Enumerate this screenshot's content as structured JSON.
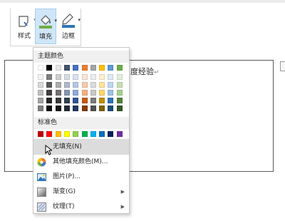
{
  "ribbon": {
    "style_label": "样式",
    "fill_label": "填充",
    "border_label": "边框"
  },
  "document": {
    "text": "度经验",
    "paragraph_mark": "↵"
  },
  "dropdown": {
    "theme_colors_title": "主题颜色",
    "standard_colors_title": "标准色",
    "theme_top_row": [
      "#ffffff",
      "#000000",
      "#e7e6e6",
      "#44546a",
      "#4472c4",
      "#ed7d31",
      "#a5a5a5",
      "#ffc000",
      "#5b9bd5",
      "#70ad47"
    ],
    "theme_shades": [
      [
        "#f2f2f2",
        "#7f7f7f",
        "#d0cece",
        "#d6dce4",
        "#d9e2f3",
        "#fbe5d5",
        "#ededed",
        "#fff2cc",
        "#deebf6",
        "#e2efd9"
      ],
      [
        "#d8d8d8",
        "#595959",
        "#aeabab",
        "#adb9ca",
        "#b4c6e7",
        "#f7cbac",
        "#dbdbdb",
        "#fee599",
        "#bdd7ee",
        "#c5e0b3"
      ],
      [
        "#bfbfbf",
        "#3f3f3f",
        "#757070",
        "#8496b0",
        "#8eaadb",
        "#f4b183",
        "#c9c9c9",
        "#ffd965",
        "#9cc3e5",
        "#a8d08d"
      ],
      [
        "#a5a5a5",
        "#262626",
        "#3a3838",
        "#323f4f",
        "#2f5496",
        "#c55a11",
        "#7b7b7b",
        "#bf9000",
        "#2e75b5",
        "#538135"
      ],
      [
        "#7f7f7f",
        "#0c0c0c",
        "#171616",
        "#222a35",
        "#1f3864",
        "#833c0b",
        "#525252",
        "#7f6000",
        "#1e4e79",
        "#375623"
      ]
    ],
    "standard_colors": [
      "#c00000",
      "#ff0000",
      "#ffc000",
      "#ffff00",
      "#92d050",
      "#00b050",
      "#00b0f0",
      "#0070c0",
      "#002060",
      "#7030a0"
    ],
    "items": [
      {
        "label": "无填充(N)"
      },
      {
        "label": "其他填充颜色(M)..."
      },
      {
        "label": "图片(P)..."
      },
      {
        "label": "渐变(G)"
      },
      {
        "label": "纹理(T)"
      }
    ]
  }
}
